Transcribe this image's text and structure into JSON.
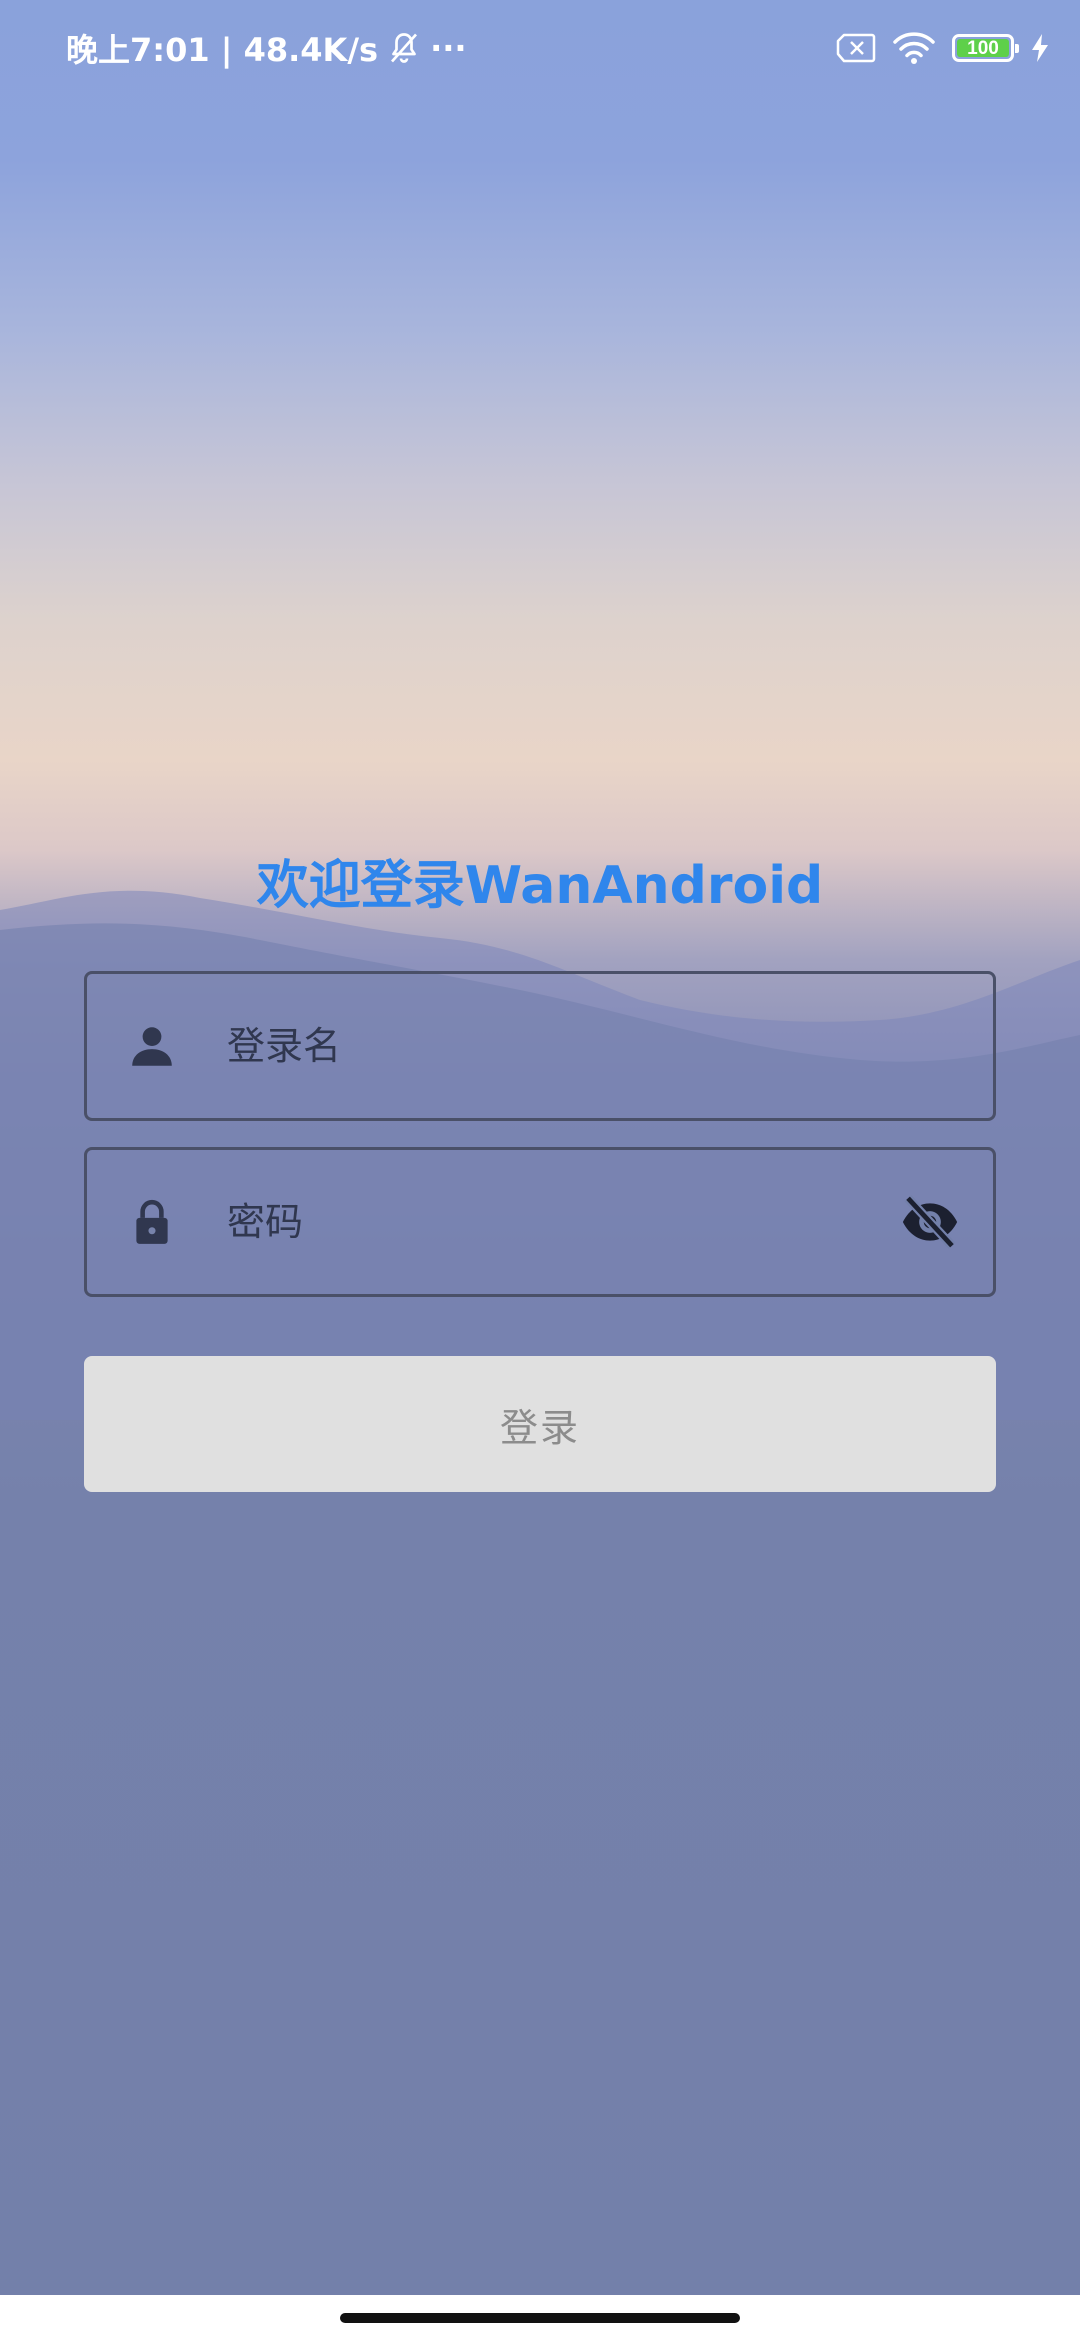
{
  "status_bar": {
    "time_and_speed": "晚上7:01 | 48.4K/s",
    "more": "···",
    "battery_level": "100",
    "icons": [
      "mute-bell-icon",
      "sim-off-icon",
      "wifi-icon",
      "battery-icon",
      "charging-bolt-icon"
    ]
  },
  "login": {
    "title": "欢迎登录WanAndroid",
    "username_placeholder": "登录名",
    "password_placeholder": "密码",
    "login_button": "登录"
  },
  "colors": {
    "title": "#2f86ec",
    "button_bg": "#e0e0e0",
    "button_text": "#8c8c8c",
    "field_border": "#4a5068",
    "battery": "#5ed04a"
  }
}
